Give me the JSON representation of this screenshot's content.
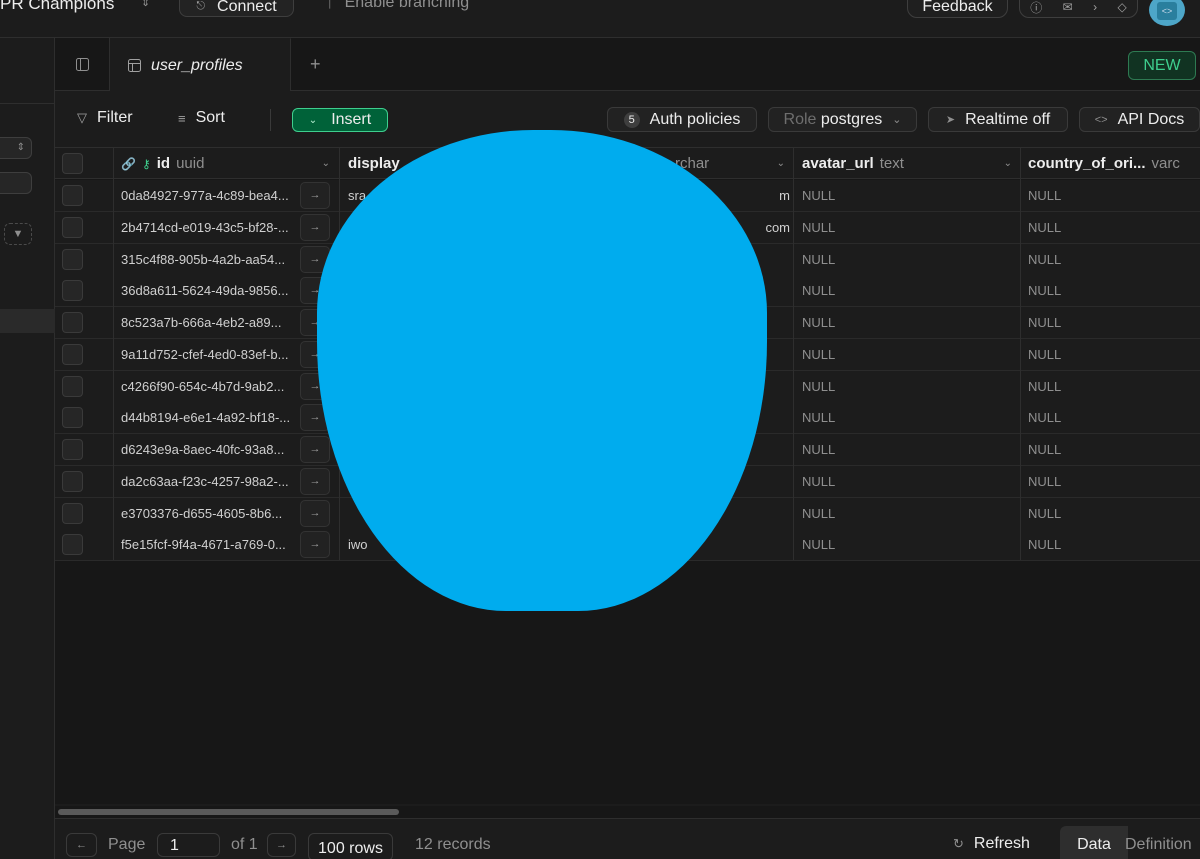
{
  "topbar": {
    "project_name": "PR Champions",
    "connect_label": "Connect",
    "branching_label": "Enable branching",
    "feedback_label": "Feedback"
  },
  "tabs": {
    "active_tab": "user_profiles",
    "new_label": "NEW"
  },
  "toolbar": {
    "filter_label": "Filter",
    "sort_label": "Sort",
    "insert_label": "Insert",
    "auth_policies_count": "5",
    "auth_policies_label": "Auth policies",
    "role_label": "Role",
    "role_value": "postgres",
    "realtime_label": "Realtime off",
    "api_docs_label": "API Docs"
  },
  "columns": [
    {
      "name": "id",
      "type": "uuid"
    },
    {
      "name": "display",
      "type": ""
    },
    {
      "name": "",
      "type": "rchar"
    },
    {
      "name": "avatar_url",
      "type": "text"
    },
    {
      "name": "country_of_ori...",
      "type": "varc"
    }
  ],
  "rows": [
    {
      "id": "0da84927-977a-4c89-bea4...",
      "display": "sra",
      "email": "m",
      "avatar": "NULL",
      "country": "NULL"
    },
    {
      "id": "2b4714cd-e019-43c5-bf28-...",
      "display": "",
      "email": "com",
      "avatar": "NULL",
      "country": "NULL"
    },
    {
      "id": "315c4f88-905b-4a2b-aa54...",
      "display": "",
      "email": "",
      "avatar": "NULL",
      "country": "NULL"
    },
    {
      "id": "36d8a611-5624-49da-9856...",
      "display": "",
      "email": "",
      "avatar": "NULL",
      "country": "NULL"
    },
    {
      "id": "8c523a7b-666a-4eb2-a89...",
      "display": "",
      "email": "",
      "avatar": "NULL",
      "country": "NULL"
    },
    {
      "id": "9a11d752-cfef-4ed0-83ef-b...",
      "display": "",
      "email": "",
      "avatar": "NULL",
      "country": "NULL"
    },
    {
      "id": "c4266f90-654c-4b7d-9ab2...",
      "display": "",
      "email": "",
      "avatar": "NULL",
      "country": "NULL"
    },
    {
      "id": "d44b8194-e6e1-4a92-bf18-...",
      "display": "",
      "email": "",
      "avatar": "NULL",
      "country": "NULL"
    },
    {
      "id": "d6243e9a-8aec-40fc-93a8...",
      "display": "",
      "email": "",
      "avatar": "NULL",
      "country": "NULL"
    },
    {
      "id": "da2c63aa-f23c-4257-98a2-...",
      "display": "",
      "email": "",
      "avatar": "NULL",
      "country": "NULL"
    },
    {
      "id": "e3703376-d655-4605-8b6...",
      "display": "",
      "email": "",
      "avatar": "NULL",
      "country": "NULL"
    },
    {
      "id": "f5e15fcf-9f4a-4671-a769-0...",
      "display": "iwo",
      "email": "",
      "avatar": "NULL",
      "country": "NULL"
    }
  ],
  "footer": {
    "page_label": "Page",
    "page_value": "1",
    "of_label": "of 1",
    "rows_label": "100 rows",
    "records_label": "12 records",
    "refresh_label": "Refresh",
    "data_label": "Data",
    "definition_label": "Definition"
  },
  "colors": {
    "accent": "#3ecf8e",
    "background": "#1c1c1c",
    "redaction": "#00acee"
  }
}
